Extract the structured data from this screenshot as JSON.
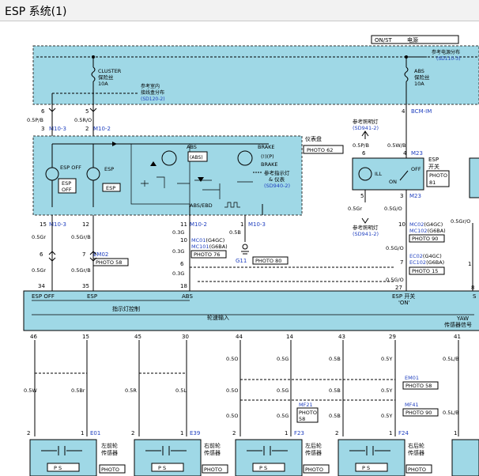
{
  "title": "ESP 系统(1)",
  "colors": {
    "panel": "#9fd8e6",
    "link": "#1f3fbf",
    "wire": "#000000"
  },
  "power": {
    "switch": "ON/ST",
    "label": "电源",
    "ref": "参考电源分布",
    "ref_code": "(SD110-3)"
  },
  "fuses": {
    "cluster": {
      "name": "CLUSTER",
      "line2": "保险丝",
      "rating": "10A"
    },
    "abs": {
      "name": "ABS",
      "line2": "保险丝",
      "rating": "10A"
    },
    "ref_interior": {
      "line1": "参考室内",
      "line2": "接线盒分布",
      "code": "(SD120-2)"
    },
    "bcm": "BCM-IM"
  },
  "cluster_block": {
    "title": "仪表盘",
    "photo": "PHOTO 62",
    "esp_off_icon": "ESP OFF",
    "esp_off_box": [
      "ESP",
      "OFF"
    ],
    "esp_icon": "ESP",
    "esp_box": "ESP",
    "abs_label": "ABS",
    "abs_symbol": "(ABS)",
    "brake_label": "BRAKE",
    "brake_symbol": "(!)(P)",
    "brake_sub": "BRAKE",
    "ref_indicator": [
      "参考指示灯",
      "& 仪表"
    ],
    "ref_indicator_code": "(SD940-2)",
    "abs_ebd": "ABS/EBD"
  },
  "esp_switch": {
    "title": "ESP",
    "sub": "开关",
    "photo": "PHOTO",
    "photo_num": "81",
    "ill": "ILL",
    "on": "ON",
    "off": "OFF",
    "ref_illum": "参考照明灯",
    "ref_illum_code": "(SD941-2)"
  },
  "left_pins": [
    {
      "pin": "6",
      "wire": "0.5P/B"
    },
    {
      "pin": "3",
      "conn": "M10-3"
    },
    {
      "pin": "5",
      "wire": "0.5R/O"
    },
    {
      "pin": "2",
      "conn": "M10-2"
    }
  ],
  "connectors": {
    "m10_3": "M10-3",
    "m10_2": "M10-2",
    "m23": "M23",
    "em02": "EM02",
    "photo_58": "PHOTO 58",
    "mc01": "MC01",
    "mc01_var": "(G4GC)",
    "mc101": "MC101",
    "mc101_var": "(G6BA)",
    "photo_76": "PHOTO 76",
    "g11": "G11",
    "photo_80": "PHOTO 80",
    "mc02": "MC02",
    "mc02_var": "(G4GC)",
    "mc102": "MC102",
    "mc102_var": "(G6BA)",
    "photo_90": "PHOTO 90",
    "ec02": "EC02",
    "ec02_var": "(G4GC)",
    "ec102": "EC102",
    "ec102_var": "(G6BA)",
    "photo_15": "PHOTO 15",
    "em01": "EM01",
    "mf21": "MF21",
    "mf21_photo": "PHOTO",
    "mf21_photo_num": "58",
    "mf41": "MF41"
  },
  "mid_wires": {
    "p15": "15",
    "p12": "12",
    "p11": "11",
    "p10": "10",
    "p1": "1",
    "w_05gr": "0.5Gr",
    "w_05grb": "0.5Gr/B",
    "w_03g": "0.3G",
    "w_05b": "0.5B",
    "p6": "6",
    "p7": "7",
    "p5": "5",
    "p3": "3",
    "w_05gr2": "0.5Gr",
    "w_05go": "0.5G/O",
    "w_05wb": "0.5W/B",
    "w_05pb": "0.5P/B",
    "p10b": "10",
    "p1b": "1",
    "p7b": "7",
    "p6b": "6",
    "p27": "27",
    "p8": "8",
    "p34": "34",
    "p35": "35",
    "p18": "18",
    "w_05go2": "0.5G/O",
    "w_05gro": "0.5Gr/O",
    "p4": "4"
  },
  "esp_module": {
    "top_labels": [
      "ESP OFF",
      "ESP",
      "ABS",
      "ESP 开关",
      "'ON'",
      "S"
    ],
    "indicator_ctrl": "指示灯控制",
    "wheel_input": "轮速输入",
    "yaw": "YAW",
    "yaw_sub": "传感器信号"
  },
  "module_pins": [
    "46",
    "15",
    "45",
    "30",
    "44",
    "14",
    "43",
    "29",
    "41"
  ],
  "sensor_wires": {
    "w_05w": "0.5W",
    "w_05br": "0.5Br",
    "w_05r": "0.5R",
    "w_05l": "0.5L",
    "w_05o": "0.5O",
    "w_05g": "0.5G",
    "w_05b": "0.5B",
    "w_05y": "0.5Y",
    "w_05lb": "0.5L/B"
  },
  "sensors": [
    {
      "conn": "E01",
      "name": "左前轮",
      "sub": "传感器"
    },
    {
      "conn": "E39",
      "name": "右前轮",
      "sub": "传感器"
    },
    {
      "conn": "F23",
      "name": "左后轮",
      "sub": "传感器"
    },
    {
      "conn": "F24",
      "name": "右后轮",
      "sub": "传感器"
    }
  ],
  "sensor_pins": {
    "p2": "2",
    "p1": "1",
    "photo": "PHOTO",
    "ps": "P   S"
  }
}
